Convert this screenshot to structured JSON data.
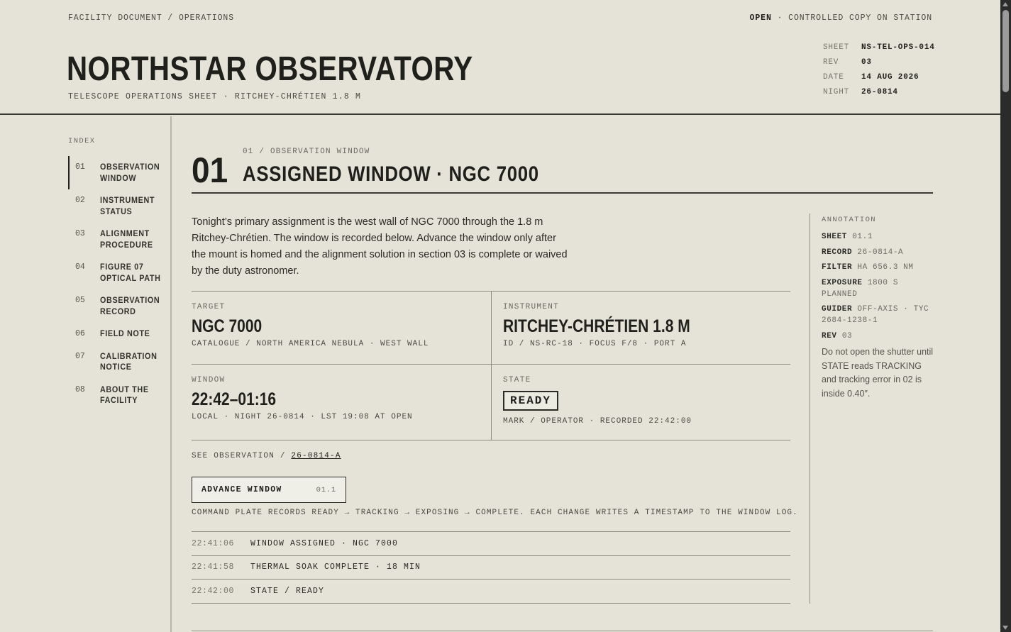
{
  "header": {
    "breadcrumb": "FACILITY DOCUMENT / OPERATIONS",
    "status_open": "OPEN",
    "status_rest": " · CONTROLLED COPY ON STATION",
    "title": "NORTHSTAR OBSERVATORY",
    "subtitle": "TELESCOPE OPERATIONS SHEET · RITCHEY-CHRÉTIEN 1.8 M",
    "meta": [
      {
        "key": "SHEET",
        "value": "NS-TEL-OPS-014"
      },
      {
        "key": "REV",
        "value": "03"
      },
      {
        "key": "DATE",
        "value": "14 AUG 2026"
      },
      {
        "key": "NIGHT",
        "value": "26-0814"
      }
    ]
  },
  "sidebar": {
    "index_label": "INDEX",
    "items": [
      {
        "num": "01",
        "label": "OBSERVATION WINDOW"
      },
      {
        "num": "02",
        "label": "INSTRUMENT STATUS"
      },
      {
        "num": "03",
        "label": "ALIGNMENT PROCEDURE"
      },
      {
        "num": "04",
        "label": "FIGURE 07 OPTICAL PATH"
      },
      {
        "num": "05",
        "label": "OBSERVATION RECORD"
      },
      {
        "num": "06",
        "label": "FIELD NOTE"
      },
      {
        "num": "07",
        "label": "CALIBRATION NOTICE"
      },
      {
        "num": "08",
        "label": "ABOUT THE FACILITY"
      }
    ]
  },
  "section": {
    "number": "01",
    "kicker": "01 / OBSERVATION WINDOW",
    "title": "ASSIGNED WINDOW · NGC 7000",
    "intro": "Tonight’s primary assignment is the west wall of NGC 7000 through the 1.8 m Ritchey-Chrétien. The window is recorded below. Advance the window only after the mount is homed and the alignment solution in section 03 is complete or waived by the duty astronomer.",
    "target": {
      "label": "TARGET",
      "value": "NGC 7000",
      "sub": "CATALOGUE / NORTH AMERICA NEBULA · WEST WALL"
    },
    "instrument": {
      "label": "INSTRUMENT",
      "value": "RITCHEY-CHRÉTIEN 1.8 M",
      "sub": "ID / NS-RC-18 · FOCUS F/8 · PORT A"
    },
    "window": {
      "label": "WINDOW",
      "value": "22:42–01:16",
      "sub": "LOCAL · NIGHT 26-0814 · LST 19:08 AT OPEN"
    },
    "state": {
      "label": "STATE",
      "value": "READY",
      "sub": "MARK / OPERATOR · RECORDED 22:42:00"
    },
    "see_prefix": "SEE OBSERVATION / ",
    "see_link": "26-0814-A",
    "advance_label": "ADVANCE WINDOW",
    "advance_ref": "01.1",
    "command_note": "COMMAND PLATE RECORDS READY → TRACKING → EXPOSING → COMPLETE. EACH CHANGE WRITES A TIMESTAMP TO THE WINDOW LOG.",
    "log": [
      {
        "time": "22:41:06",
        "text": "WINDOW ASSIGNED · NGC 7000"
      },
      {
        "time": "22:41:58",
        "text": "THERMAL SOAK COMPLETE · 18 MIN"
      },
      {
        "time": "22:42:00",
        "text": "STATE / READY"
      }
    ]
  },
  "annotation": {
    "title": "ANNOTATION",
    "rows": [
      {
        "key": "SHEET",
        "value": "01.1"
      },
      {
        "key": "RECORD",
        "value": "26-0814-A"
      },
      {
        "key": "FILTER",
        "value": "HA 656.3 NM"
      },
      {
        "key": "EXPOSURE",
        "value": "1800 S PLANNED"
      },
      {
        "key": "GUIDER",
        "value": "OFF-AXIS · TYC 2684-1238-1"
      },
      {
        "key": "REV",
        "value": "03"
      }
    ],
    "note": "Do not open the shutter until STATE reads TRACKING and tracking error in 02 is inside 0.40″."
  }
}
